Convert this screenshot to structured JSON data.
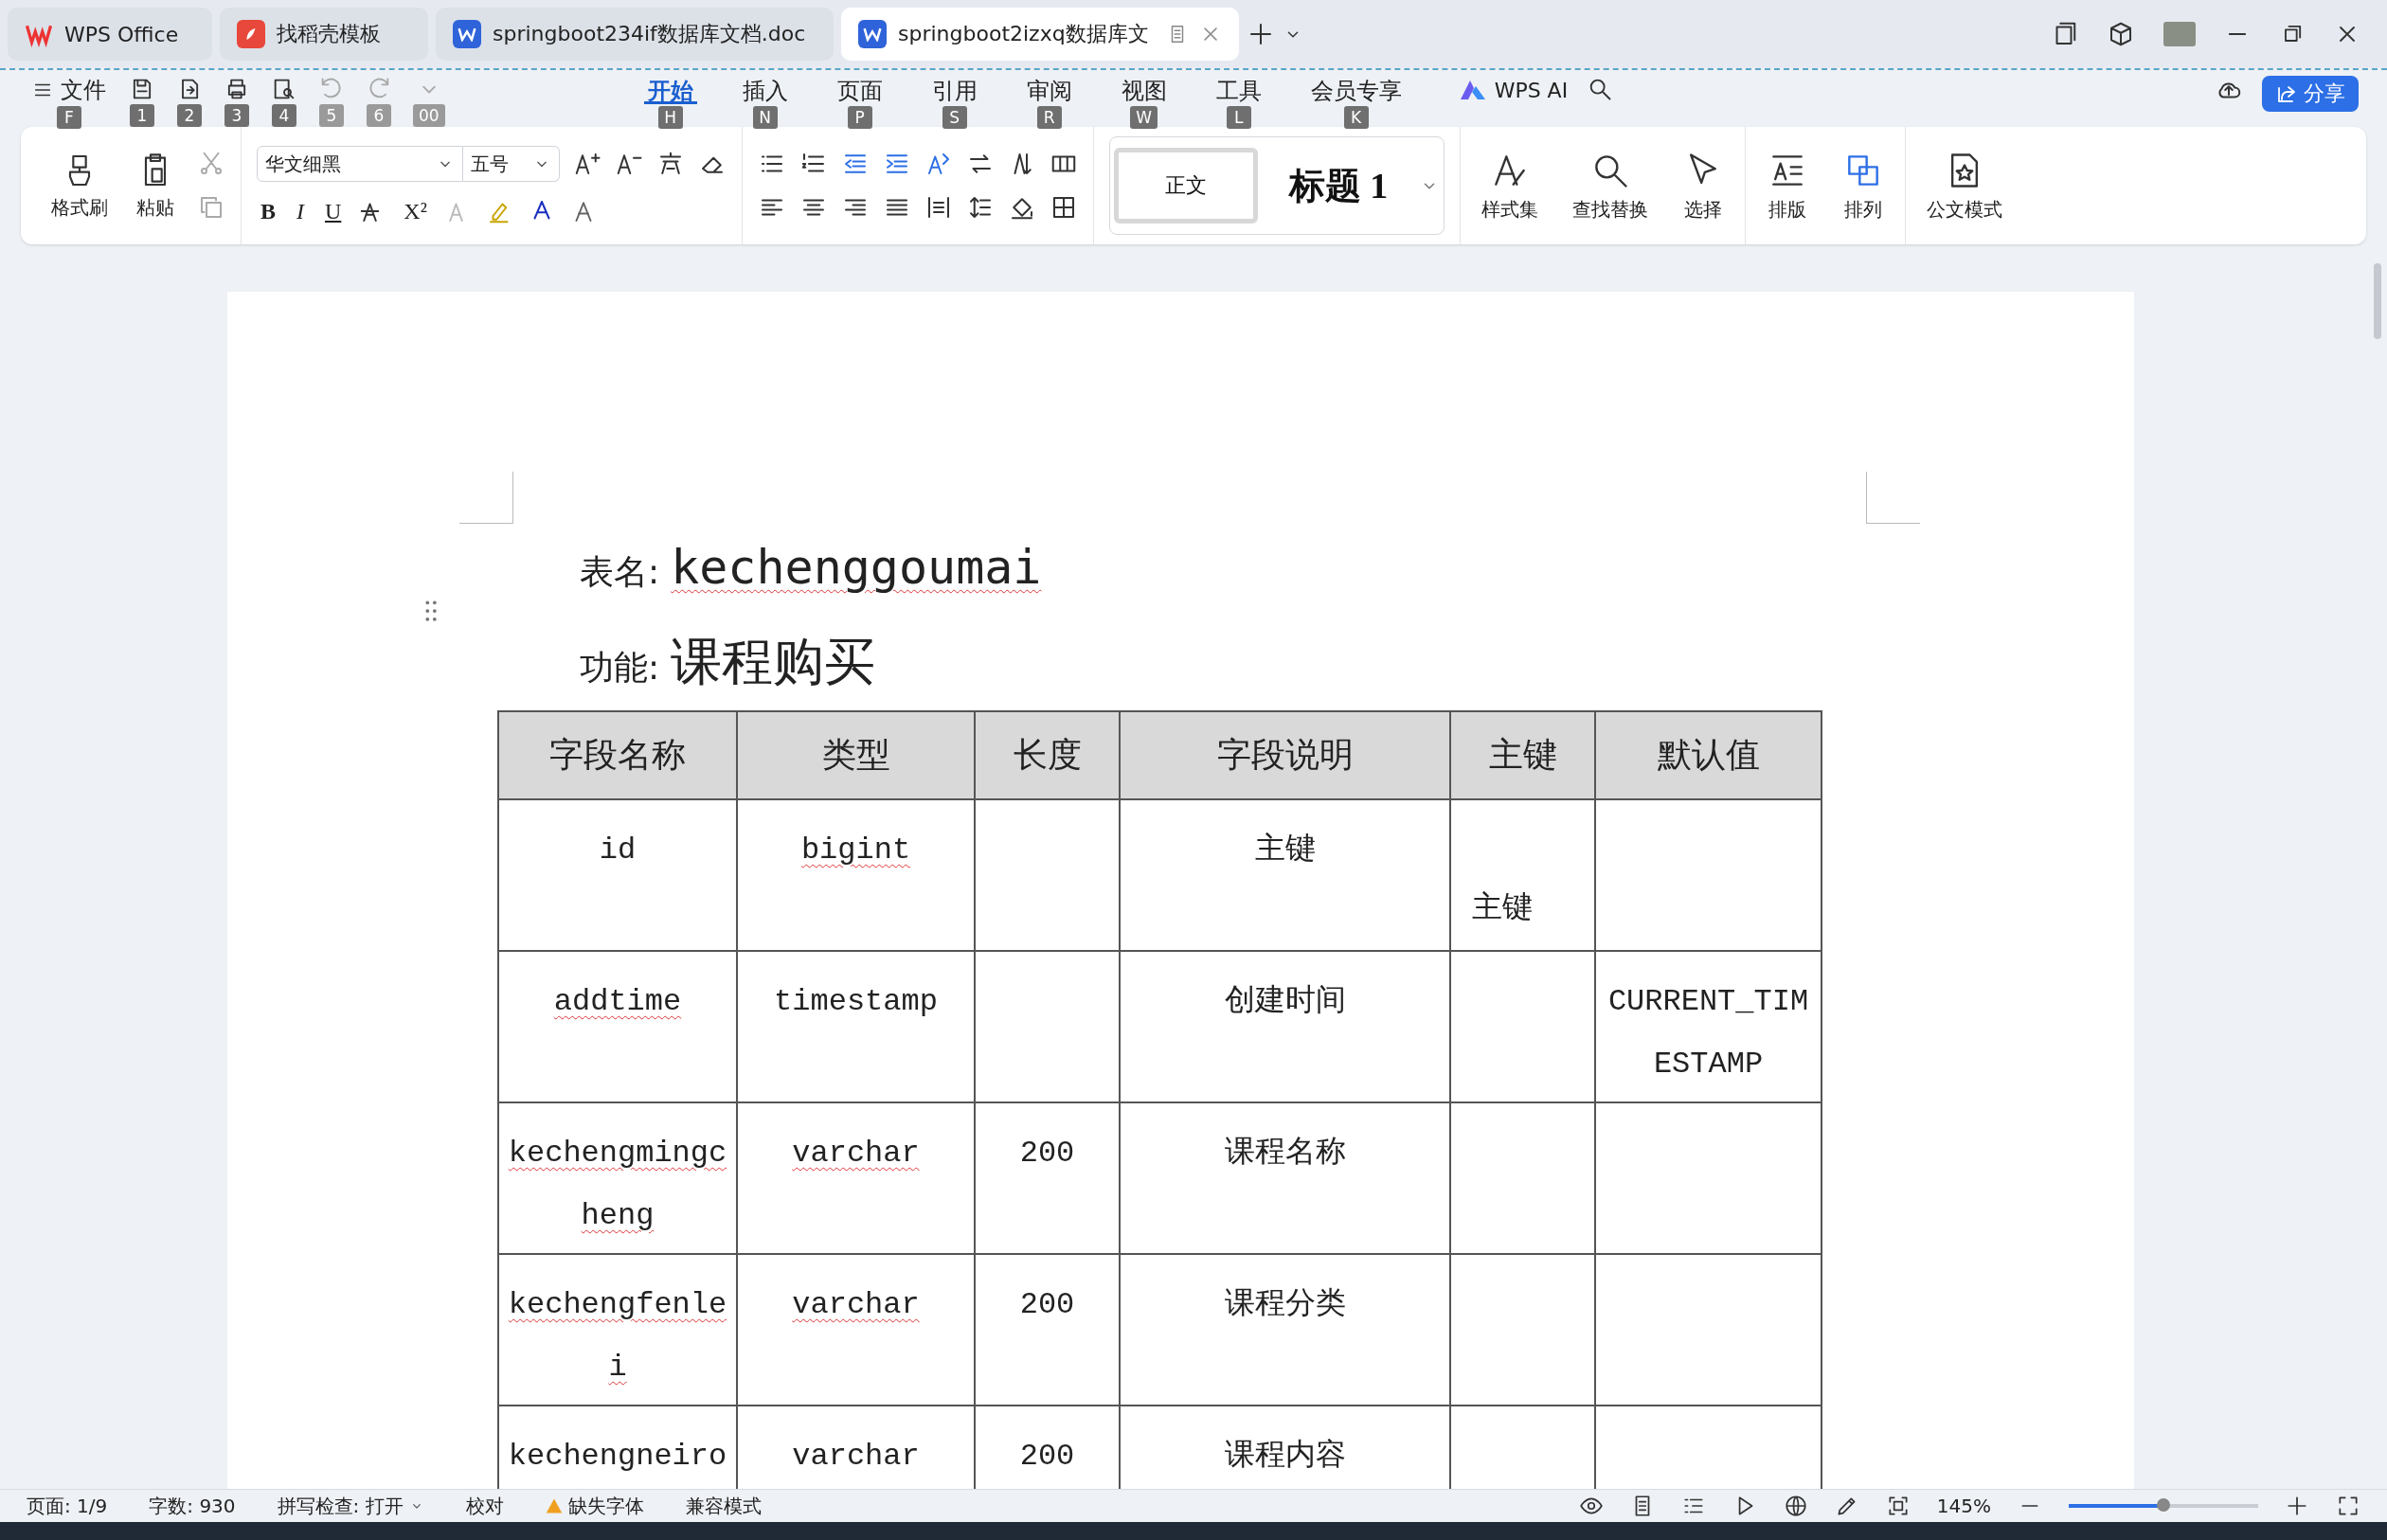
{
  "tabs": [
    {
      "kind": "home",
      "label": "WPS Office",
      "selected": false
    },
    {
      "kind": "template",
      "label": "找稻壳模板",
      "selected": false
    },
    {
      "kind": "doc",
      "label": "springboot234if数据库文档.doc",
      "selected": false
    },
    {
      "kind": "doc",
      "label": "springboot2izxq数据库文",
      "selected": true
    }
  ],
  "menu": {
    "file": "文件",
    "file_key": "F",
    "quick_keys": [
      "1",
      "2",
      "3",
      "4",
      "5",
      "6",
      "00"
    ],
    "tabs": [
      {
        "label": "开始",
        "key": "H",
        "selected": true
      },
      {
        "label": "插入",
        "key": "N",
        "selected": false
      },
      {
        "label": "页面",
        "key": "P",
        "selected": false
      },
      {
        "label": "引用",
        "key": "S",
        "selected": false
      },
      {
        "label": "审阅",
        "key": "R",
        "selected": false
      },
      {
        "label": "视图",
        "key": "W",
        "selected": false
      },
      {
        "label": "工具",
        "key": "L",
        "selected": false
      },
      {
        "label": "会员专享",
        "key": "K",
        "selected": false
      }
    ],
    "ai": "WPS AI",
    "share": "分享"
  },
  "ribbon": {
    "format_painter": "格式刷",
    "paste": "粘贴",
    "font_name": "华文细黑",
    "font_size": "五号",
    "bold": "B",
    "italic": "I",
    "underline": "U",
    "superscript": "X²",
    "styles": [
      {
        "label": "正文",
        "selected": true
      },
      {
        "label": "标题 1",
        "selected": false
      }
    ],
    "tools": [
      {
        "kind": "styles",
        "label": "样式集"
      },
      {
        "kind": "find",
        "label": "查找替换"
      },
      {
        "kind": "select",
        "label": "选择"
      },
      {
        "kind": "layout",
        "label": "排版"
      },
      {
        "kind": "arrange",
        "label": "排列"
      },
      {
        "kind": "official",
        "label": "公文模式"
      }
    ]
  },
  "document": {
    "name_label": "表名:",
    "name": "kechenggoumai",
    "function_label": "功能:",
    "function": "课程购买",
    "table": {
      "columns": [
        "字段名称",
        "类型",
        "长度",
        "字段说明",
        "主键",
        "默认值"
      ],
      "rows": [
        [
          {
            "text": "id"
          },
          {
            "text": "bigint",
            "spell_error": true
          },
          {},
          {
            "text": "主键"
          },
          {
            "text": "主键"
          },
          {}
        ],
        [
          {
            "text": "addtime",
            "spell_error": true
          },
          {
            "text": "timestamp"
          },
          {},
          {
            "text": "创建时间"
          },
          {},
          {
            "text": "CURRENT_TIMESTAMP"
          }
        ],
        [
          {
            "text": "kechengmingcheng",
            "spell_error": true
          },
          {
            "text": "varchar",
            "spell_error": true
          },
          {
            "text": "200"
          },
          {
            "text": "课程名称"
          },
          {},
          {}
        ],
        [
          {
            "text": "kechengfenlei",
            "spell_error": true
          },
          {
            "text": "varchar",
            "spell_error": true
          },
          {
            "text": "200"
          },
          {
            "text": "课程分类"
          },
          {},
          {}
        ],
        [
          {
            "text": "kechengneiro",
            "spell_error": false
          },
          {
            "text": "varchar",
            "spell_error": false
          },
          {
            "text": "200"
          },
          {
            "text": "课程内容"
          },
          {},
          {}
        ]
      ]
    }
  },
  "status_bar": {
    "items": [
      {
        "kind": "text",
        "label": "页面: 1/9"
      },
      {
        "kind": "text",
        "label": "字数: 930"
      },
      {
        "kind": "dropdown",
        "label": "拼写检查: 打开"
      },
      {
        "kind": "text",
        "label": "校对"
      },
      {
        "kind": "warning",
        "label": "缺失字体"
      },
      {
        "kind": "text",
        "label": "兼容模式"
      }
    ],
    "zoom": "145%",
    "zoom_slider": {
      "level": 0.5
    }
  }
}
